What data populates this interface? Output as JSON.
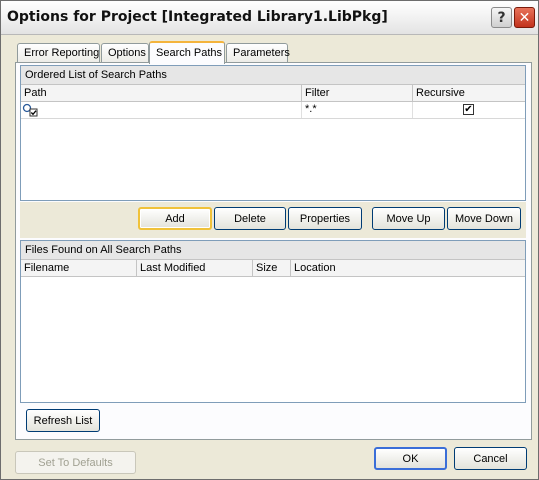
{
  "window": {
    "title": "Options for Project [Integrated Library1.LibPkg]",
    "help_label": "?",
    "close_label": "✕"
  },
  "tabs": [
    {
      "label": "Error Reporting"
    },
    {
      "label": "Options"
    },
    {
      "label": "Search Paths"
    },
    {
      "label": "Parameters"
    }
  ],
  "search_paths": {
    "header": "Ordered List of Search Paths",
    "columns": {
      "path": "Path",
      "filter": "Filter",
      "recursive": "Recursive"
    },
    "rows": [
      {
        "path": "",
        "filter": "*.*",
        "recursive": true
      }
    ]
  },
  "buttons": {
    "add": "Add",
    "delete": "Delete",
    "properties": "Properties",
    "move_up": "Move Up",
    "move_down": "Move Down",
    "refresh": "Refresh List",
    "set_defaults": "Set To Defaults",
    "ok": "OK",
    "cancel": "Cancel"
  },
  "files_found": {
    "header": "Files Found on All Search Paths",
    "columns": {
      "filename": "Filename",
      "last_modified": "Last Modified",
      "size": "Size",
      "location": "Location"
    }
  },
  "icons": {
    "row_icon": "path-folder-icon",
    "check": "✔"
  },
  "colors": {
    "accent_tab": "#f4b43c",
    "close": "#c2321c",
    "border": "#7f9db9"
  }
}
